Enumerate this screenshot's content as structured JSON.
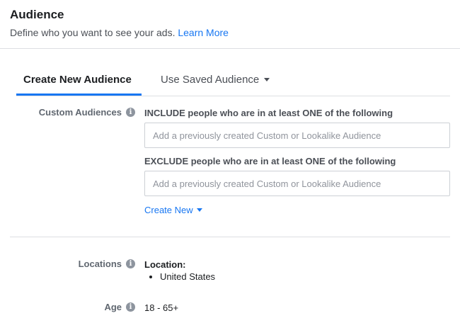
{
  "header": {
    "title": "Audience",
    "subtitle": "Define who you want to see your ads.",
    "learn_more": "Learn More"
  },
  "tabs": [
    {
      "label": "Create New Audience",
      "active": true
    },
    {
      "label": "Use Saved Audience",
      "active": false
    }
  ],
  "custom_audiences": {
    "label": "Custom Audiences",
    "include_heading": "INCLUDE people who are in at least ONE of the following",
    "include_placeholder": "Add a previously created Custom or Lookalike Audience",
    "exclude_heading": "EXCLUDE people who are in at least ONE of the following",
    "exclude_placeholder": "Add a previously created Custom or Lookalike Audience",
    "create_new": "Create New"
  },
  "locations": {
    "label": "Locations",
    "heading": "Location:",
    "items": [
      "United States"
    ]
  },
  "age": {
    "label": "Age",
    "value": "18 - 65+"
  },
  "icons": {
    "info": "info-icon",
    "dropdown": "caret-down-icon"
  },
  "colors": {
    "accent": "#1877f2",
    "divider": "#dddfe2",
    "label": "#606770"
  }
}
